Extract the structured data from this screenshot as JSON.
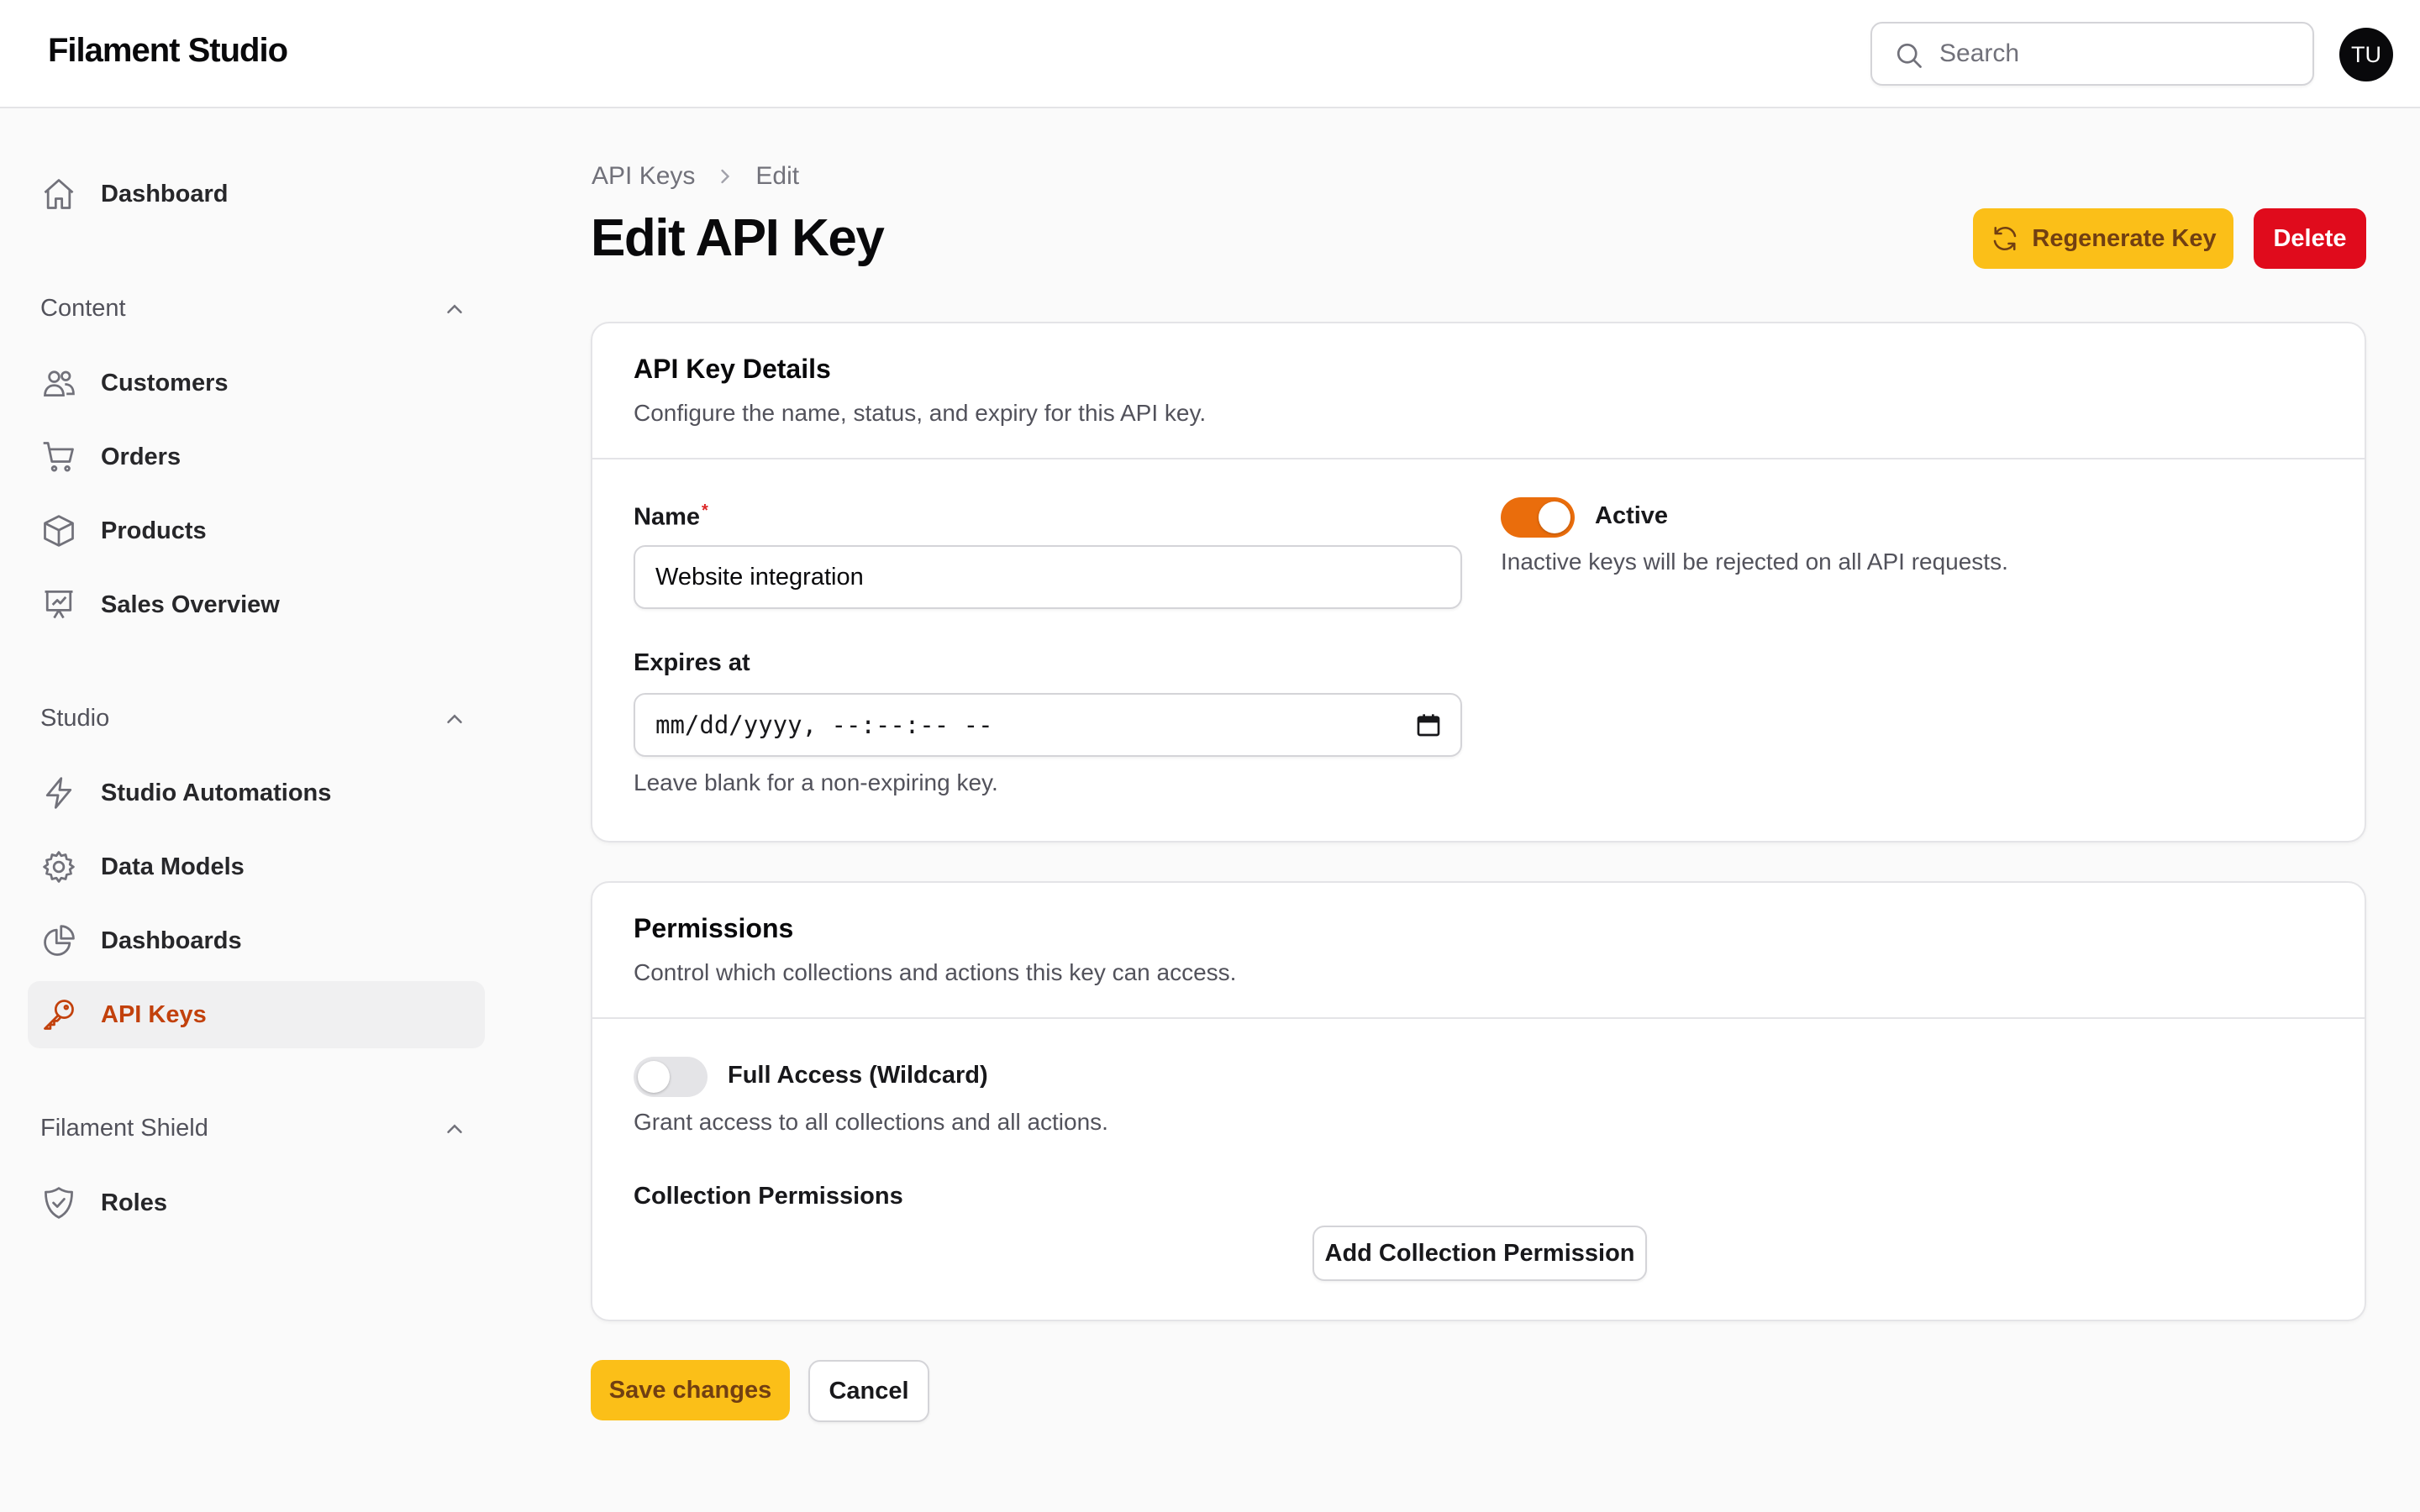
{
  "app": {
    "brand": "Filament Studio",
    "avatar_initials": "TU"
  },
  "search": {
    "placeholder": "Search"
  },
  "sidebar": {
    "dashboard": "Dashboard",
    "groups": {
      "content": "Content",
      "studio": "Studio",
      "shield": "Filament Shield"
    },
    "items": {
      "customers": "Customers",
      "orders": "Orders",
      "products": "Products",
      "sales_overview": "Sales Overview",
      "studio_automations": "Studio Automations",
      "data_models": "Data Models",
      "dashboards": "Dashboards",
      "api_keys": "API Keys",
      "roles": "Roles"
    },
    "active_item": "api_keys"
  },
  "breadcrumb": {
    "parent": "API Keys",
    "current": "Edit"
  },
  "page": {
    "title": "Edit API Key",
    "regenerate_label": "Regenerate Key",
    "delete_label": "Delete"
  },
  "details": {
    "title": "API Key Details",
    "description": "Configure the name, status, and expiry for this API key.",
    "name_label": "Name",
    "name_required": "*",
    "name_value": "Website integration",
    "expires_label": "Expires at",
    "expires_placeholder": "mm/dd/yyyy, --:--:-- --",
    "expires_helper": "Leave blank for a non-expiring key.",
    "active_label": "Active",
    "active_on": true,
    "active_helper": "Inactive keys will be rejected on all API requests."
  },
  "permissions": {
    "title": "Permissions",
    "description": "Control which collections and actions this key can access.",
    "full_access_label": "Full Access (Wildcard)",
    "full_access_on": false,
    "full_access_helper": "Grant access to all collections and all actions.",
    "collection_label": "Collection Permissions",
    "add_label": "Add Collection Permission"
  },
  "footer": {
    "save_label": "Save changes",
    "cancel_label": "Cancel"
  },
  "colors": {
    "primary": "#fbbf18",
    "danger": "#e00b1c",
    "active_nav": "#c2410c",
    "toggle_on": "#ea6d0c"
  }
}
